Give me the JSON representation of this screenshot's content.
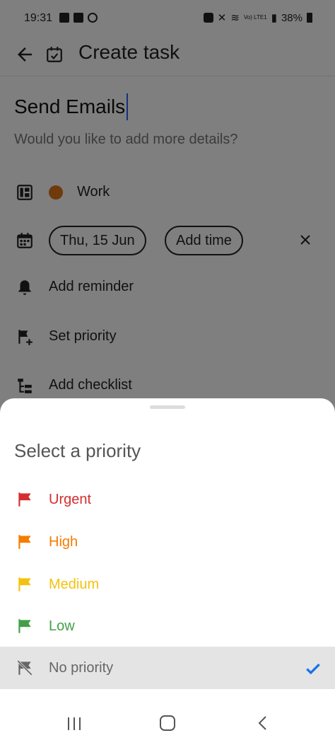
{
  "status_bar": {
    "time": "19:31",
    "battery": "38%",
    "network": "Vo) LTE1"
  },
  "app_bar": {
    "title": "Create task"
  },
  "task": {
    "title": "Send Emails",
    "description_placeholder": "Would you like to add more details?"
  },
  "list": {
    "name": "Work",
    "color": "#e07419"
  },
  "schedule": {
    "date": "Thu, 15 Jun",
    "time_label": "Add time"
  },
  "options": {
    "reminder": "Add reminder",
    "priority": "Set priority",
    "checklist": "Add checklist"
  },
  "priority_sheet": {
    "title": "Select a priority",
    "items": [
      {
        "label": "Urgent",
        "color": "#d32f2f"
      },
      {
        "label": "High",
        "color": "#f57c00"
      },
      {
        "label": "Medium",
        "color": "#f4c20d"
      },
      {
        "label": "Low",
        "color": "#43a047"
      },
      {
        "label": "No priority",
        "color": "#666666",
        "selected": true
      }
    ],
    "check_color": "#1a73e8"
  }
}
